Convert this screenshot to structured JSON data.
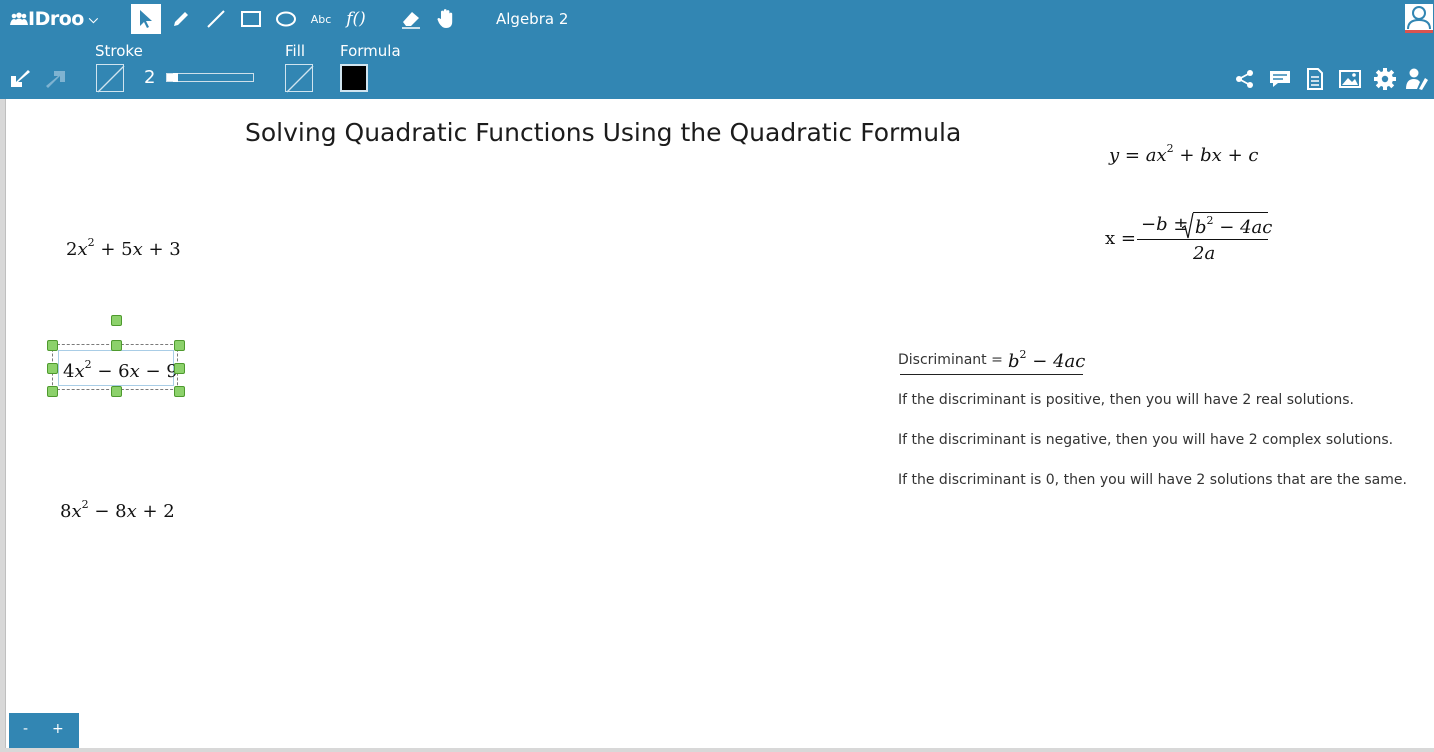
{
  "app": {
    "logo_text": "IDroo",
    "document_title": "Algebra 2"
  },
  "toolbar": {
    "tools": [
      {
        "name": "select-tool",
        "icon": "arrow-pointer-icon"
      },
      {
        "name": "pencil-tool",
        "icon": "pencil-icon"
      },
      {
        "name": "line-tool",
        "icon": "line-icon"
      },
      {
        "name": "rectangle-tool",
        "icon": "rectangle-icon"
      },
      {
        "name": "ellipse-tool",
        "icon": "ellipse-icon"
      },
      {
        "name": "text-tool",
        "label": "Abc"
      },
      {
        "name": "formula-tool",
        "label": "f()"
      },
      {
        "name": "eraser-tool",
        "icon": "eraser-icon"
      },
      {
        "name": "hand-tool",
        "icon": "hand-icon"
      }
    ],
    "stroke_label": "Stroke",
    "stroke_value": "2",
    "stroke_slider_fraction": 0.1,
    "fill_label": "Fill",
    "formula_label": "Formula",
    "formula_color": "#000000",
    "accent_color": "#3286b3",
    "right_icons": [
      "share-icon",
      "comment-icon",
      "document-icon",
      "image-icon",
      "gear-icon",
      "user-settings-icon"
    ]
  },
  "canvas": {
    "title": "Solving Quadratic Functions Using the Quadratic Formula",
    "eq1": {
      "a": "2",
      "v": "x",
      "exp": "2",
      "rest": "+ 5",
      "v2": "x",
      "tail": "+ 3"
    },
    "eq2": {
      "a": "4",
      "v": "x",
      "exp": "2",
      "rest": "− 6",
      "v2": "x",
      "tail": "− 9"
    },
    "eq3": {
      "a": "8",
      "v": "x",
      "exp": "2",
      "rest": "− 8",
      "v2": "x",
      "tail": "+ 2"
    },
    "standard_form": {
      "y": "y",
      "eq": "=",
      "ax": "ax",
      "exp": "2",
      "bx": "+ bx",
      "c": "+ c"
    },
    "quadratic_formula": {
      "lhs": "x =",
      "numerator_a": "−b ±",
      "numerator_b": "b",
      "exp": "2",
      "numerator_c": "− 4ac",
      "denominator": "2a"
    },
    "discriminant": {
      "label": "Discriminant =",
      "b": "b",
      "exp": "2",
      "rest": "− 4ac"
    },
    "notes": [
      "If the discriminant is positive, then you will have 2 real solutions.",
      "If the discriminant is negative, then you will have 2 complex solutions.",
      "If the discriminant is 0, then you will have 2 solutions that are the same."
    ]
  },
  "zoom": {
    "minus": "-",
    "plus": "+"
  }
}
